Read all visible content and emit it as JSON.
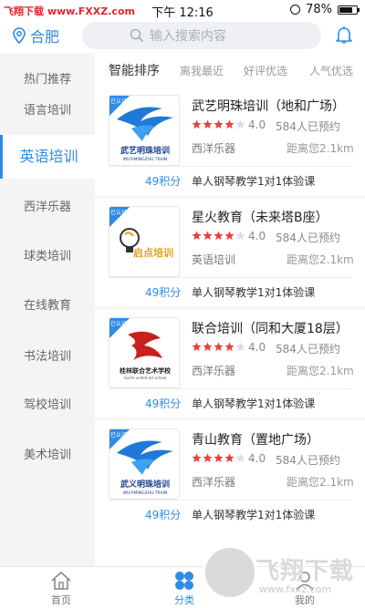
{
  "status_bar": {
    "watermark": "飞翔下载 www.FXXZ.com",
    "time": "下午 12:16",
    "battery": "78%",
    "battery_level": 0.78
  },
  "header": {
    "city": "合肥",
    "search_placeholder": "输入搜索内容"
  },
  "sidebar": {
    "items": [
      {
        "label": "热门推荐"
      },
      {
        "label": "语言培训"
      },
      {
        "label": "英语培训"
      },
      {
        "label": "西洋乐器"
      },
      {
        "label": "球类培训"
      },
      {
        "label": "在线教育"
      },
      {
        "label": "书法培训"
      },
      {
        "label": "驾校培训"
      },
      {
        "label": "美术培训"
      }
    ],
    "active_index": 2
  },
  "sort_bar": {
    "options": [
      "智能排序",
      "离我最近",
      "好评优选",
      "人气优选"
    ]
  },
  "listings": [
    {
      "name": "武艺明珠培训（地和广场）",
      "rating": "4.0",
      "booked": "584人已预约",
      "category": "西洋乐器",
      "distance": "距离您2.1km",
      "points": "49积分",
      "course": "单人钢琴教学1对1体验课",
      "logo": "武艺明珠培训",
      "logo_sub": "WUYIMINGZHU TRAIN",
      "badge": "已认证",
      "stars": 4
    },
    {
      "name": "星火教育（未来塔B座）",
      "rating": "4.0",
      "booked": "584人已预约",
      "category": "英语培训",
      "distance": "距离您2.1km",
      "points": "49积分",
      "course": "单人钢琴教学1对1体验课",
      "logo": "启点培训",
      "logo_sub": "",
      "badge": "已认证",
      "stars": 4
    },
    {
      "name": "联合培训（同和大厦18层）",
      "rating": "4.0",
      "booked": "584人已预约",
      "category": "西洋乐器",
      "distance": "距离您2.1km",
      "points": "49积分",
      "course": "单人钢琴教学1对1体验课",
      "logo": "桂林联合艺术学校",
      "logo_sub": "Guilin united art school",
      "badge": "已认证",
      "stars": 4
    },
    {
      "name": "青山教育（置地广场）",
      "rating": "4.0",
      "booked": "584人已预约",
      "category": "西洋乐器",
      "distance": "距离您2.1km",
      "points": "49积分",
      "course": "单人钢琴教学1对1体验课",
      "logo": "武义明珠培训",
      "logo_sub": "WUYIMINGZHU TRAIN",
      "badge": "已认证",
      "stars": 4
    }
  ],
  "tab_bar": {
    "tabs": [
      {
        "label": "首页"
      },
      {
        "label": "分类"
      },
      {
        "label": "我的"
      }
    ],
    "active_index": 1
  },
  "watermark_badge": {
    "text": "飞翔下载",
    "url": "www.fxxz.com"
  },
  "colors": {
    "accent": "#2f8be6",
    "star": "#e8413c"
  }
}
